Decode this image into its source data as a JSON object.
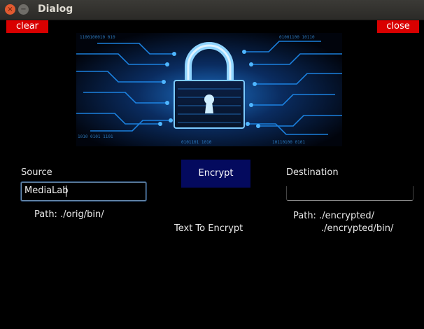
{
  "window": {
    "title": "Dialog",
    "close_glyph": "×",
    "min_glyph": "−"
  },
  "buttons": {
    "clear": "clear",
    "close": "close",
    "encrypt": "Encrypt"
  },
  "source": {
    "label": "Source",
    "value": "MediaLab",
    "path": "Path: ./orig/bin/"
  },
  "destination": {
    "label": "Destination",
    "value": "",
    "path_line1": "Path: ./encrypted/",
    "path_line2": "./encrypted/bin/"
  },
  "center": {
    "text_to_encrypt": "Text To Encrypt"
  },
  "banner": {
    "icon": "padlock-circuit-image"
  },
  "colors": {
    "accent_red": "#d90000",
    "encrypt_bg": "#040a5e",
    "banner_glow": "#1fa0ff"
  }
}
